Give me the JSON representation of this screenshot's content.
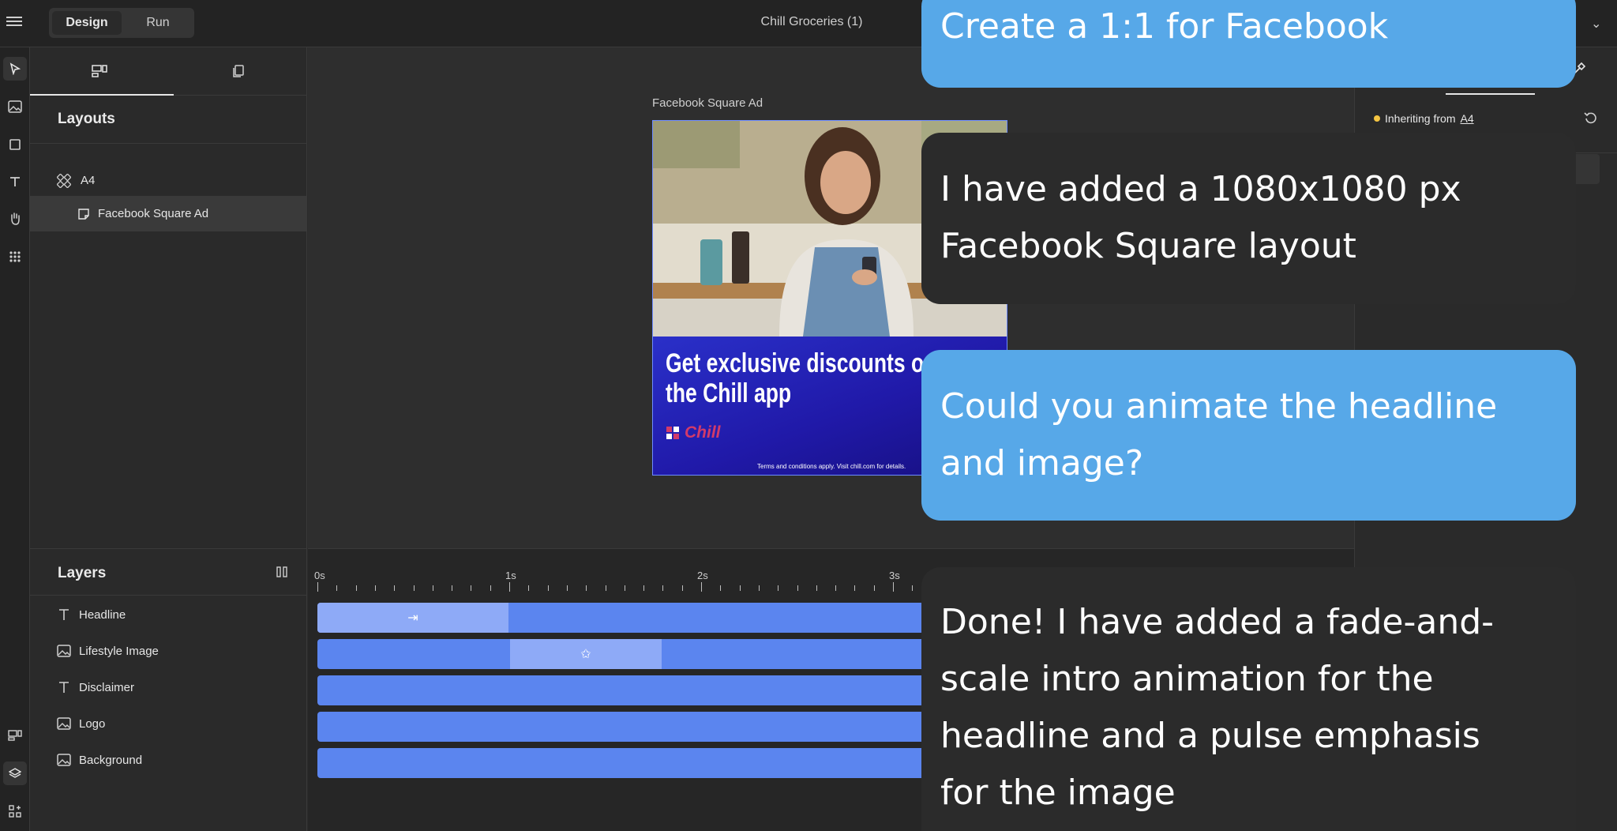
{
  "topbar": {
    "tab_design": "Design",
    "tab_run": "Run",
    "document_title": "Chill Groceries (1)"
  },
  "layouts_panel": {
    "title": "Layouts",
    "items": [
      {
        "label": "A4"
      },
      {
        "label": "Facebook Square Ad"
      }
    ]
  },
  "canvas": {
    "artboard_label": "Facebook Square Ad",
    "ad": {
      "headline_line1": "Get exclusive discounts on",
      "headline_line2": "the Chill app",
      "logo_text": "Chill",
      "disclaimer": "Terms and conditions apply. Visit chill.com for details."
    }
  },
  "layers_panel": {
    "title": "Layers",
    "items": [
      {
        "label": "Headline",
        "icon": "text-icon"
      },
      {
        "label": "Lifestyle Image",
        "icon": "image-icon"
      },
      {
        "label": "Disclaimer",
        "icon": "text-icon"
      },
      {
        "label": "Logo",
        "icon": "image-icon"
      },
      {
        "label": "Background",
        "icon": "image-icon"
      }
    ]
  },
  "timeline": {
    "ticks": [
      "0s",
      "1s",
      "2s",
      "3s"
    ]
  },
  "properties_panel": {
    "inheriting_prefix": "Inheriting from",
    "inheriting_from": "A4"
  },
  "chat": {
    "user_1": "Create a 1:1 for Facebook",
    "ai_1_line1": "I have added a 1080x1080 px",
    "ai_1_line2": "Facebook Square layout",
    "user_2_line1": "Could you animate the headline",
    "user_2_line2": "and image?",
    "ai_2_line1": "Done! I have added a fade-and-",
    "ai_2_line2": "scale intro animation for the",
    "ai_2_line3": "headline and a pulse emphasis",
    "ai_2_line4": "for the image"
  },
  "colors": {
    "accent": "#5b85ef",
    "chat_user": "#57a8e8",
    "ad_background": "#2019a8",
    "logo": "#d23a6a"
  }
}
